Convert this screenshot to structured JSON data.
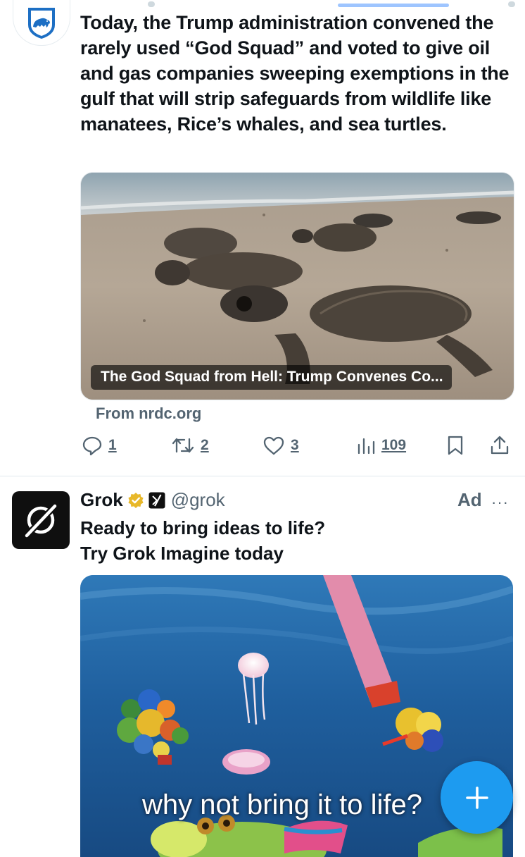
{
  "post1": {
    "text": "Today, the Trump administration convened the rarely used “God Squad” and voted to give oil and gas companies sweeping exemptions in the gulf that will strip safeguards from wildlife like manatees, Rice’s whales, and sea turtles.",
    "card": {
      "caption": "The God Squad from Hell: Trump Convenes Co...",
      "source": "From nrdc.org"
    },
    "actions": {
      "reply_count": "1",
      "repost_count": "2",
      "like_count": "3",
      "views_count": "109"
    }
  },
  "post2": {
    "name": "Grok",
    "handle": "@grok",
    "ad_label": "Ad",
    "more": "···",
    "text_line1": "Ready to bring ideas to life?",
    "text_line2": "Try Grok Imagine today",
    "overlay_text": "why not bring it to life?"
  },
  "colors": {
    "accent": "#1d9bf0",
    "secondary_text": "#536471",
    "verified_gold": "#e8b82a"
  },
  "icons": [
    "nrdc-logo",
    "reply-icon",
    "repost-icon",
    "like-icon",
    "views-icon",
    "bookmark-icon",
    "share-icon",
    "grok-logo",
    "verified-badge-icon",
    "x-affiliate-icon",
    "more-icon",
    "compose-plus-icon"
  ]
}
